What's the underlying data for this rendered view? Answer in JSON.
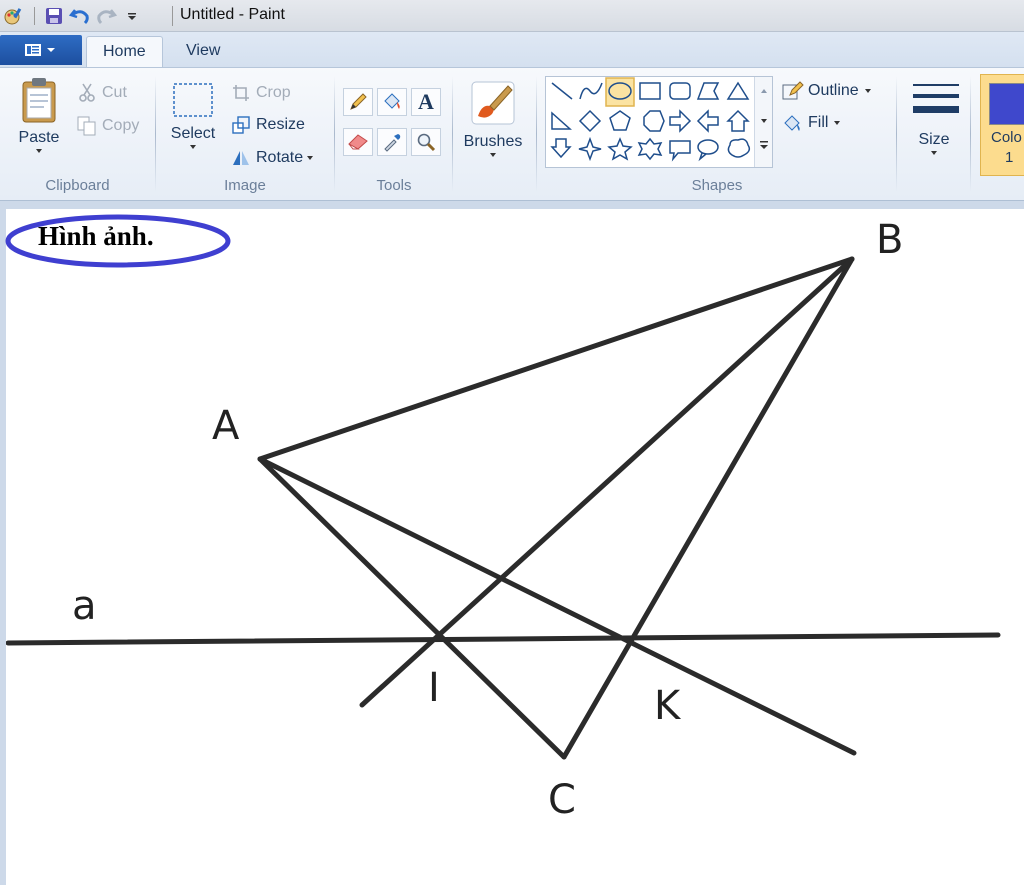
{
  "window": {
    "title": "Untitled - Paint"
  },
  "tabs": [
    {
      "label": "Home",
      "active": true
    },
    {
      "label": "View",
      "active": false
    }
  ],
  "clipboard": {
    "paste_label": "Paste",
    "cut_label": "Cut",
    "copy_label": "Copy",
    "group_label": "Clipboard"
  },
  "image": {
    "select_label": "Select",
    "crop_label": "Crop",
    "resize_label": "Resize",
    "rotate_label": "Rotate",
    "group_label": "Image"
  },
  "tools": {
    "group_label": "Tools"
  },
  "brushes": {
    "label": "Brushes"
  },
  "shapes": {
    "outline_label": "Outline",
    "fill_label": "Fill",
    "group_label": "Shapes",
    "selected": "oval"
  },
  "size": {
    "label": "Size"
  },
  "color1": {
    "label": "Colo",
    "sub": "1",
    "color": "#3f48cc"
  },
  "colors": {
    "accent": "#2e6cc4",
    "outline_oval": "#3f3fd0"
  },
  "canvas": {
    "caption": "Hình ảnh.",
    "labels": {
      "A": "A",
      "B": "B",
      "C": "C",
      "I": "I",
      "K": "K",
      "a": "a"
    }
  }
}
